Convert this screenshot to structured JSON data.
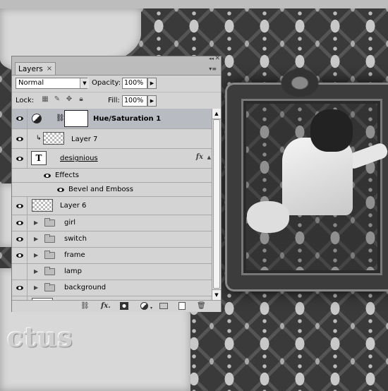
{
  "panel": {
    "tab_label": "Layers",
    "tab_close_glyph": "×",
    "collapse_glyph": "◂◂",
    "close_glyph": "✕",
    "menu_glyph": "▾≡"
  },
  "controls": {
    "blend_mode": "Normal",
    "opacity_label": "Opacity:",
    "opacity_value": "100%",
    "lock_label": "Lock:",
    "fill_label": "Fill:",
    "fill_value": "100%"
  },
  "layers": [
    {
      "name": "Hue/Saturation 1",
      "type": "adjustment",
      "visible": true,
      "selected": true
    },
    {
      "name": "Layer 7",
      "type": "pixel-clipped",
      "visible": true
    },
    {
      "name": "designious",
      "type": "text",
      "visible": true,
      "fx": "fx"
    },
    {
      "name": "Effects",
      "type": "effects-group",
      "visible": true
    },
    {
      "name": "Bevel and Emboss",
      "type": "effect",
      "visible": true
    },
    {
      "name": "Layer 6",
      "type": "pixel",
      "visible": true
    },
    {
      "name": "girl",
      "type": "group",
      "visible": true
    },
    {
      "name": "switch",
      "type": "group",
      "visible": true
    },
    {
      "name": "frame",
      "type": "group",
      "visible": true
    },
    {
      "name": "lamp",
      "type": "group",
      "visible": false
    },
    {
      "name": "background",
      "type": "group",
      "visible": true
    }
  ],
  "text_layer_glyph": "T",
  "bottom_icons": [
    "link-icon",
    "fx-icon",
    "mask-icon",
    "adjustment-icon",
    "folder-icon",
    "new-layer-icon",
    "trash-icon"
  ],
  "canvas_text": "ctus"
}
